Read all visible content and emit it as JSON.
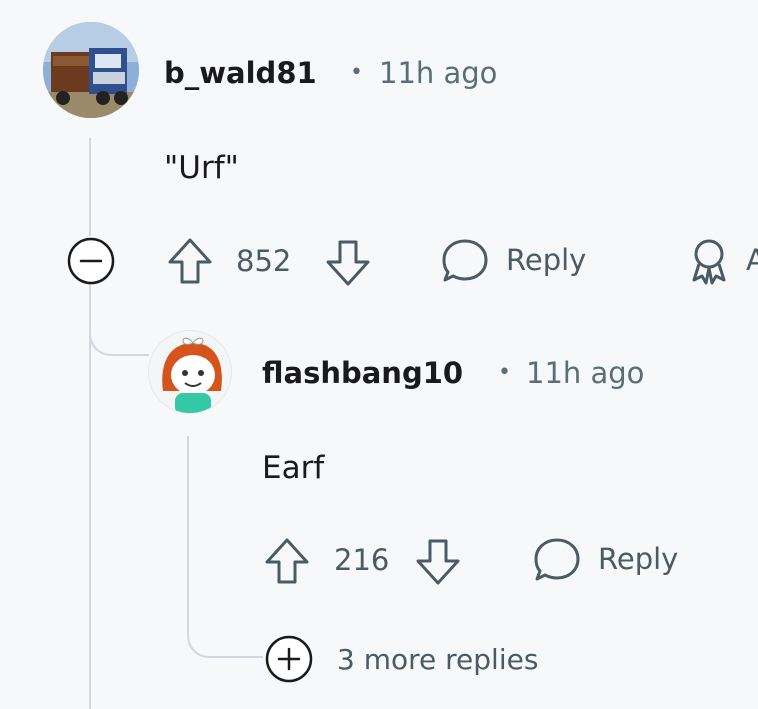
{
  "comment": {
    "username": "b_wald81",
    "time": "11h ago",
    "body": "\"Urf\"",
    "votes": "852",
    "reply_label": "Reply"
  },
  "reply": {
    "username": "flashbang10",
    "time": "11h ago",
    "body": "Earf",
    "votes": "216",
    "reply_label": "Reply",
    "more_replies": "3 more replies"
  },
  "separator": "•",
  "award_partial_label": "A"
}
